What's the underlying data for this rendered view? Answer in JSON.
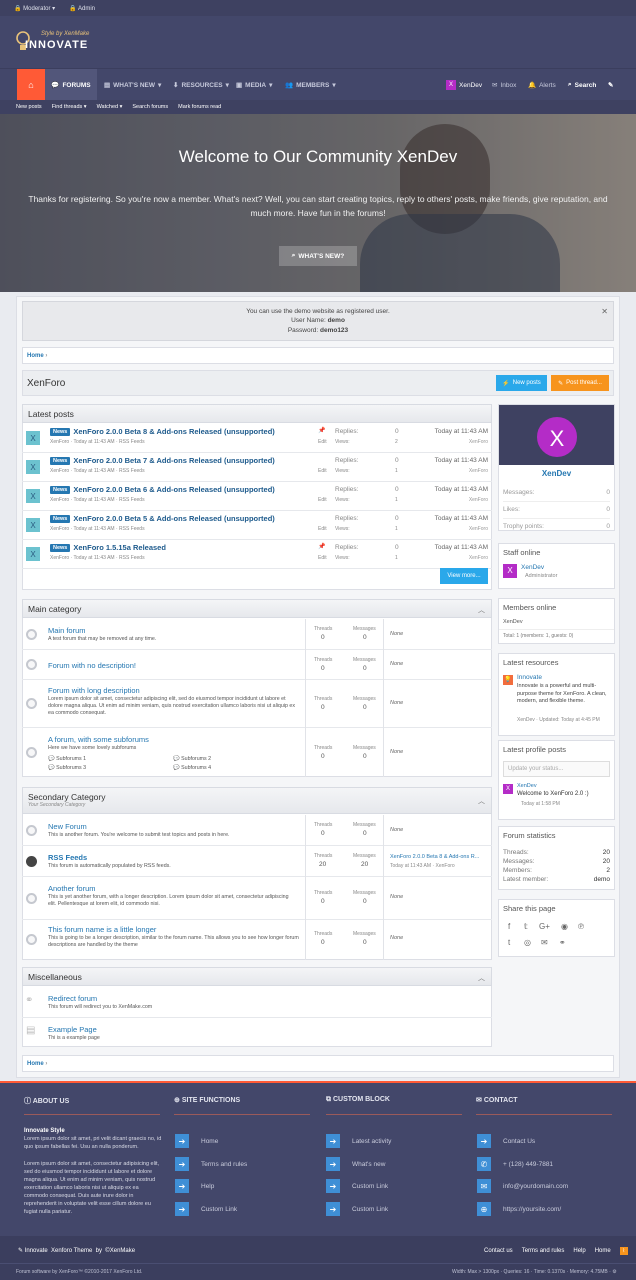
{
  "topbar": {
    "moderator": "Moderator",
    "admin": "Admin"
  },
  "logo": {
    "tagline": "Style by XenMake",
    "name": "INNOVATE"
  },
  "nav": {
    "forums": "FORUMS",
    "whats_new": "WHAT'S NEW",
    "resources": "RESOURCES",
    "media": "MEDIA",
    "members": "MEMBERS",
    "user_initial": "X",
    "user": "XenDev",
    "inbox": "Inbox",
    "alerts": "Alerts",
    "search": "Search"
  },
  "subnav": {
    "new_posts": "New posts",
    "find_threads": "Find threads",
    "watched": "Watched",
    "search_forums": "Search forums",
    "mark_read": "Mark forums read"
  },
  "hero": {
    "title": "Welcome to Our Community XenDev",
    "text": "Thanks for registering. So you're now a member. What's next? Well, you can start creating topics, reply to others' posts, make friends, give reputation, and much more. Have fun in the forums!",
    "button": "WHAT'S NEW?"
  },
  "notice": {
    "line1": "You can use the demo website as registered user.",
    "user_label": "User Name:",
    "user": "demo",
    "pass_label": "Password:",
    "pass": "demo123"
  },
  "breadcrumb": {
    "home": "Home"
  },
  "page": {
    "title": "XenForo",
    "new_posts": "New posts",
    "post_thread": "Post thread..."
  },
  "latest": {
    "title": "Latest posts",
    "view_more": "View more...",
    "replies_label": "Replies:",
    "views_label": "Views:",
    "edit": "Edit",
    "items": [
      {
        "badge": "News",
        "title": "XenForo 2.0.0 Beta 8 & Add-ons Released (unsupported)",
        "meta": "XenForo · Today at 11:43 AM · RSS Feeds",
        "replies": "0",
        "views": "2",
        "time": "Today at 11:43 AM",
        "by": "XenForo",
        "pin": true
      },
      {
        "badge": "News",
        "title": "XenForo 2.0.0 Beta 7 & Add-ons Released (unsupported)",
        "meta": "XenForo · Today at 11:43 AM · RSS Feeds",
        "replies": "0",
        "views": "1",
        "time": "Today at 11:43 AM",
        "by": "XenForo",
        "pin": false
      },
      {
        "badge": "News",
        "title": "XenForo 2.0.0 Beta 6 & Add-ons Released (unsupported)",
        "meta": "XenForo · Today at 11:43 AM · RSS Feeds",
        "replies": "0",
        "views": "1",
        "time": "Today at 11:43 AM",
        "by": "XenForo",
        "pin": false
      },
      {
        "badge": "News",
        "title": "XenForo 2.0.0 Beta 5 & Add-ons Released (unsupported)",
        "meta": "XenForo · Today at 11:43 AM · RSS Feeds",
        "replies": "0",
        "views": "1",
        "time": "Today at 11:43 AM",
        "by": "XenForo",
        "pin": false
      },
      {
        "badge": "News",
        "title": "XenForo 1.5.15a Released",
        "meta": "XenForo · Today at 11:43 AM · RSS Feeds",
        "replies": "0",
        "views": "1",
        "time": "Today at 11:43 AM",
        "by": "XenForo",
        "pin": true
      }
    ]
  },
  "cat1": {
    "title": "Main category",
    "forums": [
      {
        "title": "Main forum",
        "desc": "A test forum that may be removed at any time.",
        "threads": "0",
        "messages": "0",
        "last": "None"
      },
      {
        "title": "Forum with no description!",
        "desc": "",
        "threads": "0",
        "messages": "0",
        "last": "None"
      },
      {
        "title": "Forum with long description",
        "desc": "Lorem ipsum dolor sit amet, consectetur adipiscing elit, sed do eiusmod tempor incididunt ut labore et dolore magna aliqua. Ut enim ad minim veniam, quis nostrud exercitation ullamco laboris nisi ut aliquip ex ea commodo consequat.",
        "threads": "0",
        "messages": "0",
        "last": "None"
      },
      {
        "title": "A forum, with some subforums",
        "desc": "Here we have some lovely subforums",
        "threads": "0",
        "messages": "0",
        "last": "None",
        "subs": [
          "Subforums 1",
          "Subforums 2",
          "Subforums 3",
          "Subforums 4"
        ]
      }
    ]
  },
  "cat2": {
    "title": "Secondary Category",
    "sub": "Your Secondary Category",
    "forums": [
      {
        "title": "New Forum",
        "desc": "This is another forum. You're welcome to submit test topics and posts in here.",
        "threads": "0",
        "messages": "0",
        "last": "None"
      },
      {
        "title": "RSS Feeds",
        "desc": "This forum is automatically populated by RSS feeds.",
        "threads": "20",
        "messages": "20",
        "last": "XenForo 2.0.0 Beta 8 & Add-ons R...",
        "last_meta": "Today at 11:43 AM · XenForo"
      },
      {
        "title": "Another forum",
        "desc": "This is yet another forum, with a longer description. Lorem ipsum dolor sit amet, consectetur adipiscing elit. Pellentesque at lorem elit, id commodo nisi.",
        "threads": "0",
        "messages": "0",
        "last": "None"
      },
      {
        "title": "This forum name is a little longer",
        "desc": "This is going to be a longer description, similar to the forum name. This allows you to see how longer forum descriptions are handled by the theme",
        "threads": "0",
        "messages": "0",
        "last": "None"
      }
    ]
  },
  "cat3": {
    "title": "Miscellaneous",
    "forums": [
      {
        "title": "Redirect forum",
        "desc": "This forum will redirect you to XenMake.com"
      },
      {
        "title": "Example Page",
        "desc": "Thi is a example page"
      }
    ]
  },
  "labels": {
    "threads": "Threads",
    "messages": "Messages"
  },
  "sidebar": {
    "profile": {
      "initial": "X",
      "name": "XenDev",
      "messages_label": "Messages:",
      "messages": "0",
      "likes_label": "Likes:",
      "likes": "0",
      "trophy_label": "Trophy points:",
      "trophy": "0"
    },
    "staff": {
      "title": "Staff online",
      "initial": "X",
      "name": "XenDev",
      "role": "Administrator"
    },
    "members": {
      "title": "Members online",
      "name": "XenDev",
      "total": "Total: 1 (members: 1, guests: 0)"
    },
    "resources": {
      "title": "Latest resources",
      "name": "Innovate",
      "desc": "Innovate is a powerful and multi-purpose theme for XenForo. A clean, modern, and flexible theme.",
      "meta": "XenDev · Updated: Today at 4:45 PM"
    },
    "profile_posts": {
      "title": "Latest profile posts",
      "placeholder": "Update your status...",
      "initial": "X",
      "name": "XenDev",
      "text": "Welcome to XenForo 2.0 :)",
      "time": "Today at 1:58 PM"
    },
    "stats": {
      "title": "Forum statistics",
      "threads_label": "Threads:",
      "threads": "20",
      "messages_label": "Messages:",
      "messages": "20",
      "members_label": "Members:",
      "members": "2",
      "latest_label": "Latest member:",
      "latest": "demo"
    },
    "share": {
      "title": "Share this page"
    }
  },
  "footer": {
    "about": {
      "title": "ABOUT US",
      "heading": "Innovate Style",
      "p1": "Lorem ipsum dolor sit amet, pri velit dicant graecis no, id quo ipsum fabellas fei. Usu an nulla ponderum.",
      "p2": "Lorem ipsum dolor sit amet, consectetur adipisicing elit, sed do eiusmod tempor incididunt ut labore et dolore magna aliqua. Ut enim ad minim veniam, quis nostrud exercitation ullamco laboris nisi ut aliquip ex ea commodo consequat. Duis aute irure dolor in reprehenderit in voluptate velit esse cillum dolore eu fugiat nulla pariatur."
    },
    "site": {
      "title": "SITE FUNCTIONS",
      "links": [
        "Home",
        "Terms and rules",
        "Help",
        "Custom Link"
      ]
    },
    "custom": {
      "title": "CUSTOM BLOCK",
      "links": [
        "Latest activity",
        "What's new",
        "Custom Link",
        "Custom Link"
      ]
    },
    "contact": {
      "title": "CONTACT",
      "links": [
        "Contact Us",
        "+ (128) 449-7881",
        "info@yourdomain.com",
        "https://yoursite.com/"
      ]
    },
    "bottom": {
      "brand": "Innovate  Xenforo Theme  by  ©XenMake",
      "links": [
        "Contact us",
        "Terms and rules",
        "Help",
        "Home"
      ],
      "copyright": "Forum software by XenForo™ ©2010-2017 XenForo Ltd.",
      "debug": "Width: Max > 1300px · Queries: 16 · Time: 0.1370s · Memory: 4.75MB ·"
    }
  },
  "colors": {
    "accent": "#ff5a36",
    "blue": "#2577b1",
    "nav": "#43476a",
    "purple": "#b42cc7"
  }
}
